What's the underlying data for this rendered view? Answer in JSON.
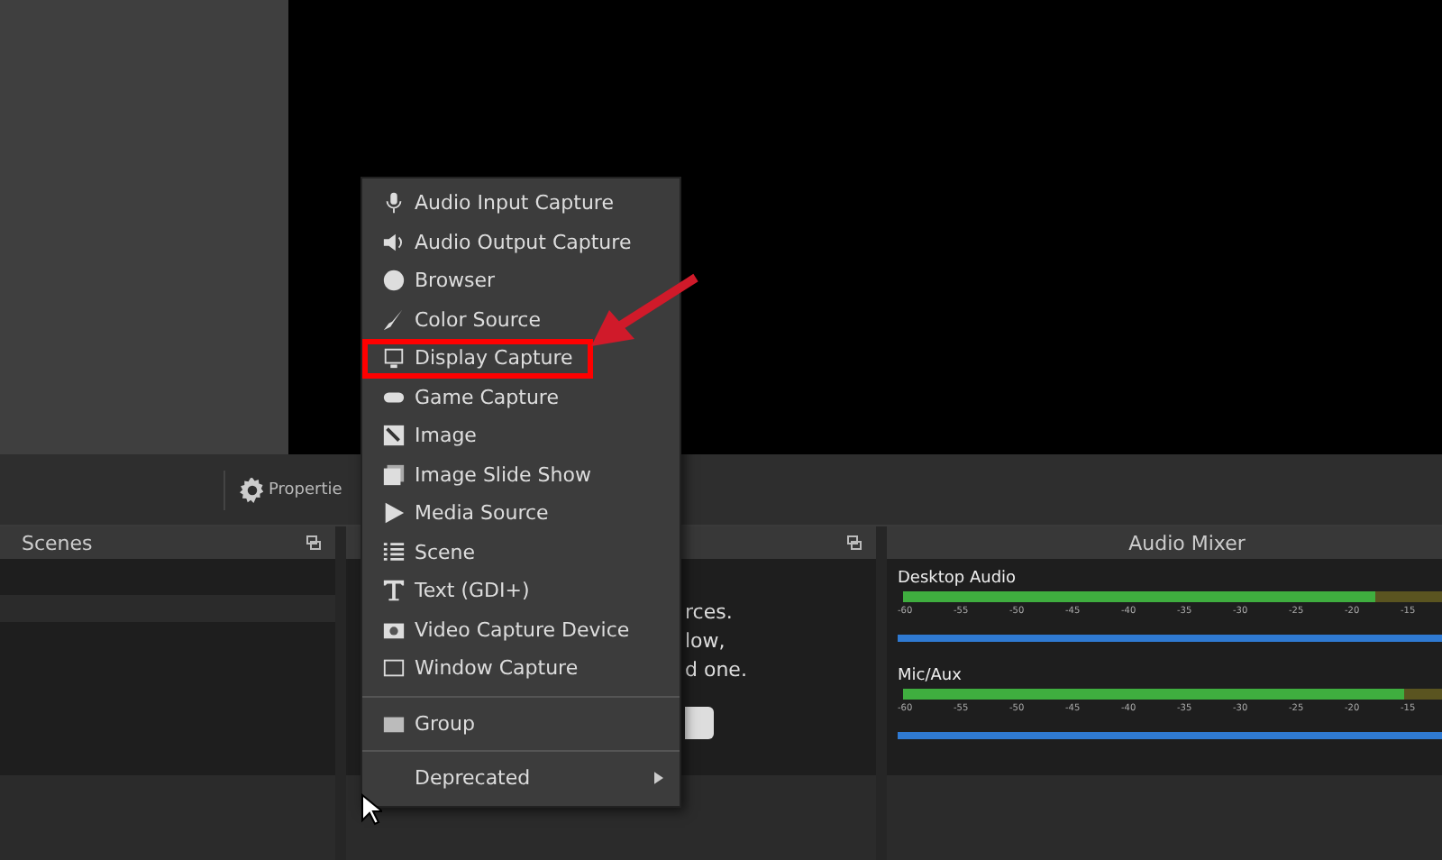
{
  "toolbar": {
    "properties_label": "Propertie"
  },
  "scenes": {
    "title": "Scenes"
  },
  "sources": {
    "hint_lines": [
      "rces.",
      "low,",
      "d one."
    ]
  },
  "mixer": {
    "title": "Audio Mixer",
    "channels": [
      {
        "name": "Desktop Audio",
        "meter": {
          "level": 0.82
        },
        "ticks": [
          "-60",
          "-55",
          "-50",
          "-45",
          "-40",
          "-35",
          "-30",
          "-25",
          "-20",
          "-15"
        ],
        "fader": {
          "level": 1
        }
      },
      {
        "name": "Mic/Aux",
        "meter": {
          "level": 0.87
        },
        "ticks": [
          "-60",
          "-55",
          "-50",
          "-45",
          "-40",
          "-35",
          "-30",
          "-25",
          "-20",
          "-15"
        ],
        "fader": {
          "level": 1
        }
      }
    ]
  },
  "menu": {
    "sections": [
      [
        {
          "label": "Audio Input Capture",
          "annotated": false,
          "has_submenu": false
        },
        {
          "label": "Audio Output Capture",
          "annotated": false,
          "has_submenu": false
        },
        {
          "label": "Browser",
          "annotated": false,
          "has_submenu": false
        },
        {
          "label": "Color Source",
          "annotated": false,
          "has_submenu": false
        },
        {
          "label": "Display Capture",
          "annotated": true,
          "has_submenu": false
        },
        {
          "label": "Game Capture",
          "annotated": false,
          "has_submenu": false
        },
        {
          "label": "Image",
          "annotated": false,
          "has_submenu": false
        },
        {
          "label": "Image Slide Show",
          "annotated": false,
          "has_submenu": false
        },
        {
          "label": "Media Source",
          "annotated": false,
          "has_submenu": false
        },
        {
          "label": "Scene",
          "annotated": false,
          "has_submenu": false
        },
        {
          "label": "Text (GDI+)",
          "annotated": false,
          "has_submenu": false
        },
        {
          "label": "Video Capture Device",
          "annotated": false,
          "has_submenu": false
        },
        {
          "label": "Window Capture",
          "annotated": false,
          "has_submenu": false
        }
      ],
      [
        {
          "label": "Group",
          "annotated": false,
          "has_submenu": false
        }
      ],
      [
        {
          "label": "Deprecated",
          "annotated": false,
          "has_submenu": true
        }
      ]
    ]
  }
}
